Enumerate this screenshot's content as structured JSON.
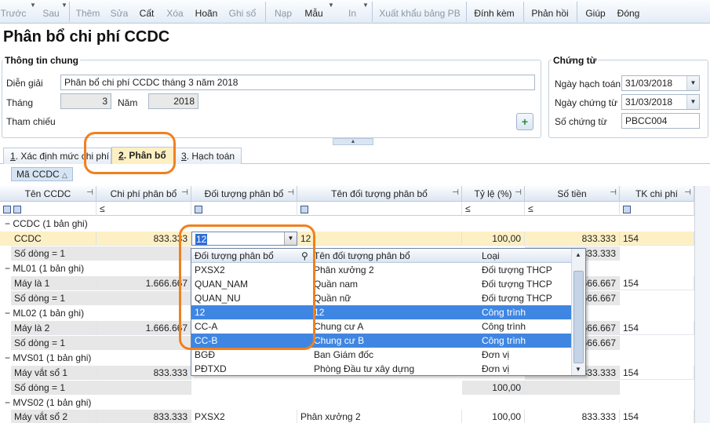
{
  "toolbar": {
    "items": [
      {
        "label": "Trước",
        "enabled": false
      },
      {
        "label": "Sau",
        "enabled": false
      },
      {
        "label": "Thêm",
        "enabled": false
      },
      {
        "label": "Sửa",
        "enabled": false
      },
      {
        "label": "Cất",
        "enabled": true
      },
      {
        "label": "Xóa",
        "enabled": false
      },
      {
        "label": "Hoãn",
        "enabled": true
      },
      {
        "label": "Ghi sổ",
        "enabled": false
      },
      {
        "label": "Nạp",
        "enabled": false
      },
      {
        "label": "Mẫu",
        "enabled": true
      },
      {
        "label": "In",
        "enabled": false
      },
      {
        "label": "Xuất khẩu bảng PB",
        "enabled": false
      },
      {
        "label": "Đính kèm",
        "enabled": true
      },
      {
        "label": "Phản hồi",
        "enabled": true
      },
      {
        "label": "Giúp",
        "enabled": true
      },
      {
        "label": "Đóng",
        "enabled": true
      }
    ]
  },
  "page_title": "Phân bổ chi phí CCDC",
  "general": {
    "title": "Thông tin chung",
    "dien_giai_label": "Diễn giải",
    "dien_giai_value": "Phân bổ chi phí CCDC tháng 3 năm 2018",
    "thang_label": "Tháng",
    "thang_value": "3",
    "nam_label": "Năm",
    "nam_value": "2018",
    "tham_chieu_label": "Tham chiếu"
  },
  "voucher": {
    "title": "Chứng từ",
    "ngay_hach_toan_label": "Ngày hạch toán",
    "ngay_hach_toan_value": "31/03/2018",
    "ngay_chung_tu_label": "Ngày chứng từ",
    "ngay_chung_tu_value": "31/03/2018",
    "so_chung_tu_label": "Số chứng từ",
    "so_chung_tu_value": "PBCC004"
  },
  "tabs": [
    {
      "num": "1",
      "label": ". Xác định mức chi phí",
      "active": false
    },
    {
      "num": "2",
      "label": ". Phân bổ",
      "active": true
    },
    {
      "num": "3",
      "label": ". Hạch toán",
      "active": false
    }
  ],
  "group_by_label": "Mã CCDC",
  "grid": {
    "columns": [
      "Tên CCDC",
      "Chi phí phân bổ",
      "Đối tượng phân bổ",
      "Tên đối tượng phân bổ",
      "Tỷ lệ (%)",
      "Số tiền",
      "TK chi phí"
    ],
    "filter_ops": [
      "■",
      "■",
      "■",
      "■",
      "≤",
      "≤",
      "■"
    ],
    "rows": [
      {
        "kind": "group",
        "text": "CCDC (1 bản ghi)"
      },
      {
        "kind": "data",
        "selected": true,
        "cells": [
          "CCDC",
          "833.333",
          "12",
          "12",
          "100,00",
          "833.333",
          "154"
        ]
      },
      {
        "kind": "sum",
        "cells": [
          "Số dòng = 1",
          "",
          "",
          "",
          "",
          "833.333",
          ""
        ]
      },
      {
        "kind": "group",
        "text": "ML01 (1 bản ghi)"
      },
      {
        "kind": "data",
        "cells": [
          "Máy là 1",
          "1.666.667",
          "",
          "",
          "",
          "1.666.667",
          "154"
        ]
      },
      {
        "kind": "sum",
        "cells": [
          "Số dòng = 1",
          "",
          "",
          "",
          "",
          "1.666.667",
          ""
        ]
      },
      {
        "kind": "group",
        "text": "ML02 (1 bản ghi)"
      },
      {
        "kind": "data",
        "cells": [
          "Máy là 2",
          "1.666.667",
          "",
          "",
          "",
          "1.666.667",
          "154"
        ]
      },
      {
        "kind": "sum",
        "cells": [
          "Số dòng = 1",
          "",
          "",
          "",
          "",
          "1.666.667",
          ""
        ]
      },
      {
        "kind": "group",
        "text": "MVS01 (1 bản ghi)"
      },
      {
        "kind": "data",
        "cells": [
          "Máy vắt sổ 1",
          "833.333",
          "",
          "",
          "",
          "833.333",
          "154"
        ]
      },
      {
        "kind": "sum",
        "cells": [
          "Số dòng = 1",
          "",
          "",
          "",
          "100,00",
          "",
          ""
        ]
      },
      {
        "kind": "group",
        "text": "MVS02 (1 bản ghi)"
      },
      {
        "kind": "data",
        "cells": [
          "Máy vắt sổ 2",
          "833.333",
          "PXSX2",
          "Phân xưởng 2",
          "100,00",
          "833.333",
          "154"
        ]
      }
    ]
  },
  "dropdown": {
    "columns": [
      "Đối tượng phân bổ",
      "Tên đối tượng phân bổ",
      "Loại"
    ],
    "rows": [
      {
        "code": "PXSX2",
        "name": "Phân xưởng 2",
        "type": "Đối tượng THCP",
        "selected": false
      },
      {
        "code": "QUAN_NAM",
        "name": "Quần nam",
        "type": "Đối tượng THCP",
        "selected": false
      },
      {
        "code": "QUAN_NU",
        "name": "Quần nữ",
        "type": "Đối tượng THCP",
        "selected": false
      },
      {
        "code": "12",
        "name": "12",
        "type": "Công trình",
        "selected": true
      },
      {
        "code": "CC-A",
        "name": "Chung cư A",
        "type": "Công trình",
        "selected": false
      },
      {
        "code": "CC-B",
        "name": "Chung cư B",
        "type": "Công trình",
        "selected": true
      },
      {
        "code": "BGĐ",
        "name": "Ban Giám đốc",
        "type": "Đơn vị",
        "selected": false
      },
      {
        "code": "PĐTXD",
        "name": "Phòng Đầu tư xây dựng",
        "type": "Đơn vị",
        "selected": false
      }
    ]
  },
  "colors": {
    "accent": "#3f86e2",
    "highlight": "#fdf0c4",
    "annotation": "#f08020"
  }
}
